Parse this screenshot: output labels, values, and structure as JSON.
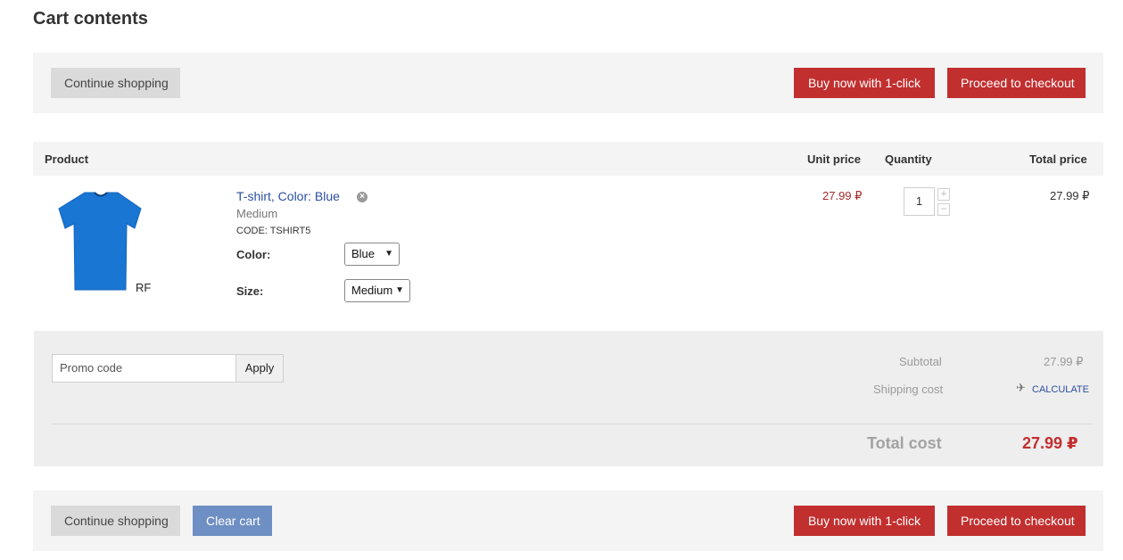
{
  "page_title": "Cart contents",
  "top_bar": {
    "continue_label": "Continue shopping",
    "buy_now_label": "Buy now with 1-click",
    "checkout_label": "Proceed to checkout"
  },
  "table": {
    "headers": {
      "product": "Product",
      "unit_price": "Unit price",
      "quantity": "Quantity",
      "total_price": "Total price"
    }
  },
  "item": {
    "name": "T-shirt, Color: Blue",
    "variant": "Medium",
    "code": "CODE: TSHIRT5",
    "image_caption": "RF",
    "options": [
      {
        "label": "Color:",
        "value": "Blue"
      },
      {
        "label": "Size:",
        "value": "Medium"
      }
    ],
    "unit_price": "27.99 ₽",
    "quantity": "1",
    "total_price": "27.99 ₽",
    "shirt_color": "#1976d2"
  },
  "summary": {
    "promo_placeholder": "Promo code",
    "apply_label": "Apply",
    "subtotal_label": "Subtotal",
    "subtotal_value": "27.99 ₽",
    "shipping_label": "Shipping cost",
    "calculate_label": "CALCULATE",
    "total_label": "Total cost",
    "total_value": "27.99 ₽"
  },
  "bottom_bar": {
    "continue_label": "Continue shopping",
    "clear_label": "Clear cart",
    "buy_now_label": "Buy now with 1-click",
    "checkout_label": "Proceed to checkout"
  },
  "colors": {
    "accent_red": "#c22f2f",
    "link_blue": "#2c4fa0",
    "clear_blue": "#6e8fc3"
  },
  "icons": {
    "remove": "remove-icon",
    "plus": "plus-icon",
    "minus": "minus-icon",
    "shipping": "airplane-icon",
    "chevron": "chevron-down-icon"
  }
}
